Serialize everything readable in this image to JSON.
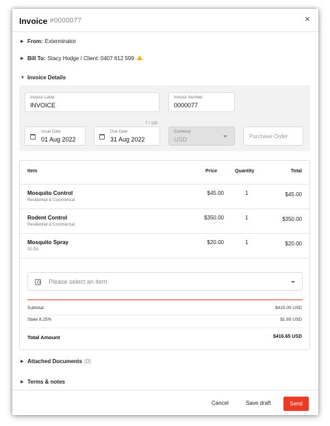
{
  "header": {
    "title": "Invoice",
    "number": "#0000077",
    "close_label": "×"
  },
  "from": {
    "label": "From:",
    "value": "Exterminator"
  },
  "bill_to": {
    "label": "Bill To:",
    "value": "Stacy Hodge / Client: 0407 612 599"
  },
  "invoice_details": {
    "heading": "Invoice Details",
    "invoice_label": {
      "label": "Invoice Label",
      "value": "INVOICE",
      "counter": "7 / 100"
    },
    "invoice_number": {
      "label": "Invoice Number",
      "value": "0000077"
    },
    "issue_date": {
      "label": "Issue Date",
      "value": "01 Aug 2022"
    },
    "due_date": {
      "label": "Due Date",
      "value": "31 Aug 2022"
    },
    "currency": {
      "label": "Currency",
      "value": "USD"
    },
    "purchase_order": {
      "placeholder": "Purchase Order"
    }
  },
  "table": {
    "headers": {
      "item": "Item",
      "price": "Price",
      "quantity": "Quantity",
      "total": "Total"
    },
    "rows": [
      {
        "name": "Mosquito Control",
        "sub": "Residential & Commercial",
        "price": "$45.00",
        "qty": "1",
        "total": "$45.00"
      },
      {
        "name": "Rodent Control",
        "sub": "Residential & Commercial",
        "price": "$350.00",
        "qty": "1",
        "total": "$350.00"
      },
      {
        "name": "Mosquito Spray",
        "sub": "32 Oz.",
        "price": "$20.00",
        "qty": "1",
        "total": "$20.00"
      }
    ],
    "select_placeholder": "Please select an item"
  },
  "summary": {
    "subtotal_label": "Subtotal",
    "subtotal_value": "$415.00 USD",
    "tax_label": "State 8.25%",
    "tax_value": "$1.65 USD",
    "total_label": "Total Amount",
    "total_value": "$416.65 USD"
  },
  "attached": {
    "label": "Attached Documents",
    "count": "(0)"
  },
  "terms": {
    "label": "Terms & notes"
  },
  "footer": {
    "cancel": "Cancel",
    "save_draft": "Save draft",
    "send": "Send"
  },
  "colors": {
    "accent": "#ef3b24",
    "warning": "#f2b100",
    "panel_bg": "#f2f2f2"
  }
}
